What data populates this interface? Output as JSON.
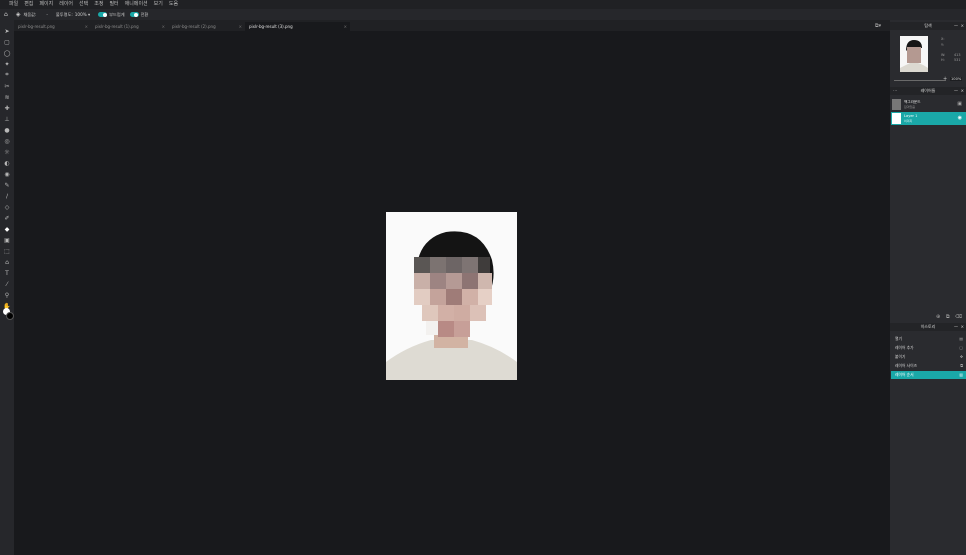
{
  "menu": [
    "파일",
    "편집",
    "페이지",
    "레이어",
    "선택",
    "조정",
    "필터",
    "애니메이션",
    "보기",
    "도움"
  ],
  "options": {
    "fill_label": "채움값:",
    "fill_value": "-",
    "opacity_label": "불투명도:",
    "opacity_value": "100% ▾",
    "toggle1_label": "부드럽게",
    "toggle2_label": "전환"
  },
  "tabs": [
    {
      "label": "pixlr-bg-result.png",
      "active": false
    },
    {
      "label": "pixlr-bg-result (1).png",
      "active": false
    },
    {
      "label": "pixlr-bg-result (2).png",
      "active": false
    },
    {
      "label": "pixlr-bg-result (3).png",
      "active": true
    }
  ],
  "tab_close": "×",
  "navigator": {
    "title": "탐색",
    "x_label": "X:",
    "y_label": "Y:",
    "w_label": "W:",
    "h_label": "H:",
    "w_value": "413",
    "h_value": "531",
    "zoom": "100%"
  },
  "layers": {
    "title": "레이어들",
    "items": [
      {
        "name": "백그라운드",
        "sub": "잠겨있음",
        "selected": false
      },
      {
        "name": "Layer 1",
        "sub": "이미지",
        "selected": true
      }
    ]
  },
  "history": {
    "title": "히스토리",
    "items": [
      {
        "label": "열기",
        "selected": false
      },
      {
        "label": "레이어 추가",
        "selected": false
      },
      {
        "label": "붙이기",
        "selected": false
      },
      {
        "label": "레이어 사이즈",
        "selected": false
      },
      {
        "label": "레이어 순서",
        "selected": true
      }
    ]
  },
  "colors": {
    "accent": "#1aa8a8",
    "panel": "#2a2b2f",
    "canvas": "#18191c"
  }
}
